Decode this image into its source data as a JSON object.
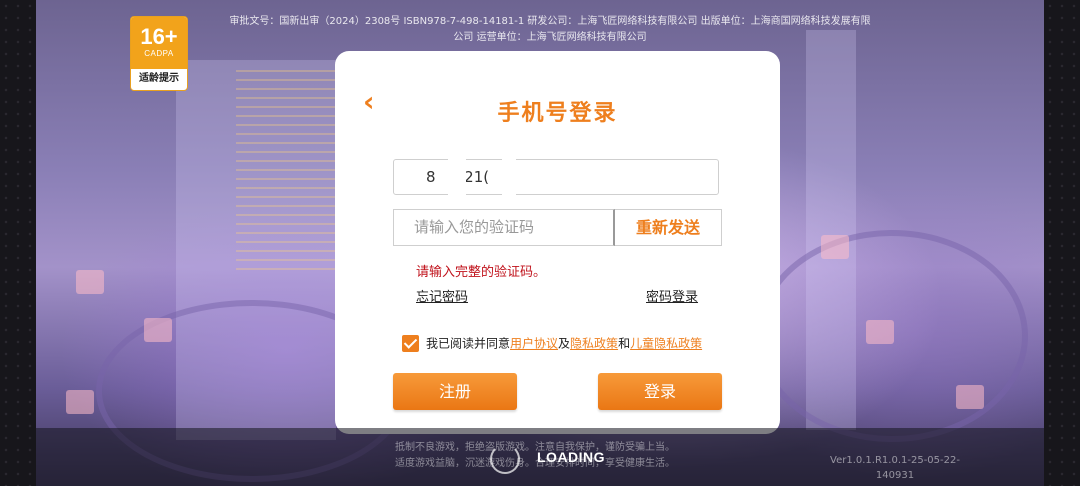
{
  "rating": {
    "age": "16+",
    "org": "CADPA",
    "tip": "适龄提示"
  },
  "license": {
    "line1": "审批文号：国新出审（2024）2308号 ISBN978-7-498-14181-1 研发公司：上海飞匠网络科技有限公司 出版单位：上海商国网络科技发展有限",
    "line2": "公司 运营单位：上海飞匠网络科技有限公司"
  },
  "login": {
    "title": "手机号登录",
    "back_icon": "chevron-left-icon",
    "phone_value": "8    721(",
    "code_placeholder": "请输入您的验证码",
    "resend_label": "重新发送",
    "error_text": "请输入完整的验证码。",
    "forgot_label": "忘记密码",
    "password_login_label": "密码登录",
    "agree_prefix": "我已阅读并同意",
    "user_agreement": "用户协议",
    "and1": "及",
    "privacy_policy": "隐私政策",
    "and2": "和",
    "child_privacy": "儿童隐私政策",
    "register_label": "注册",
    "login_label": "登录",
    "accent_color": "#EE7F1E",
    "error_color": "#C0121B"
  },
  "footer": {
    "health_line1": "抵制不良游戏，拒绝盗版游戏。注意自我保护，谨防受骗上当。",
    "health_line2": "适度游戏益脑，沉迷游戏伤身。合理安排时间，享受健康生活。",
    "loading_text": "LOADING",
    "version_line1": "Ver1.0.1.R1.0.1-25-05-22-",
    "version_line2": "140931"
  }
}
